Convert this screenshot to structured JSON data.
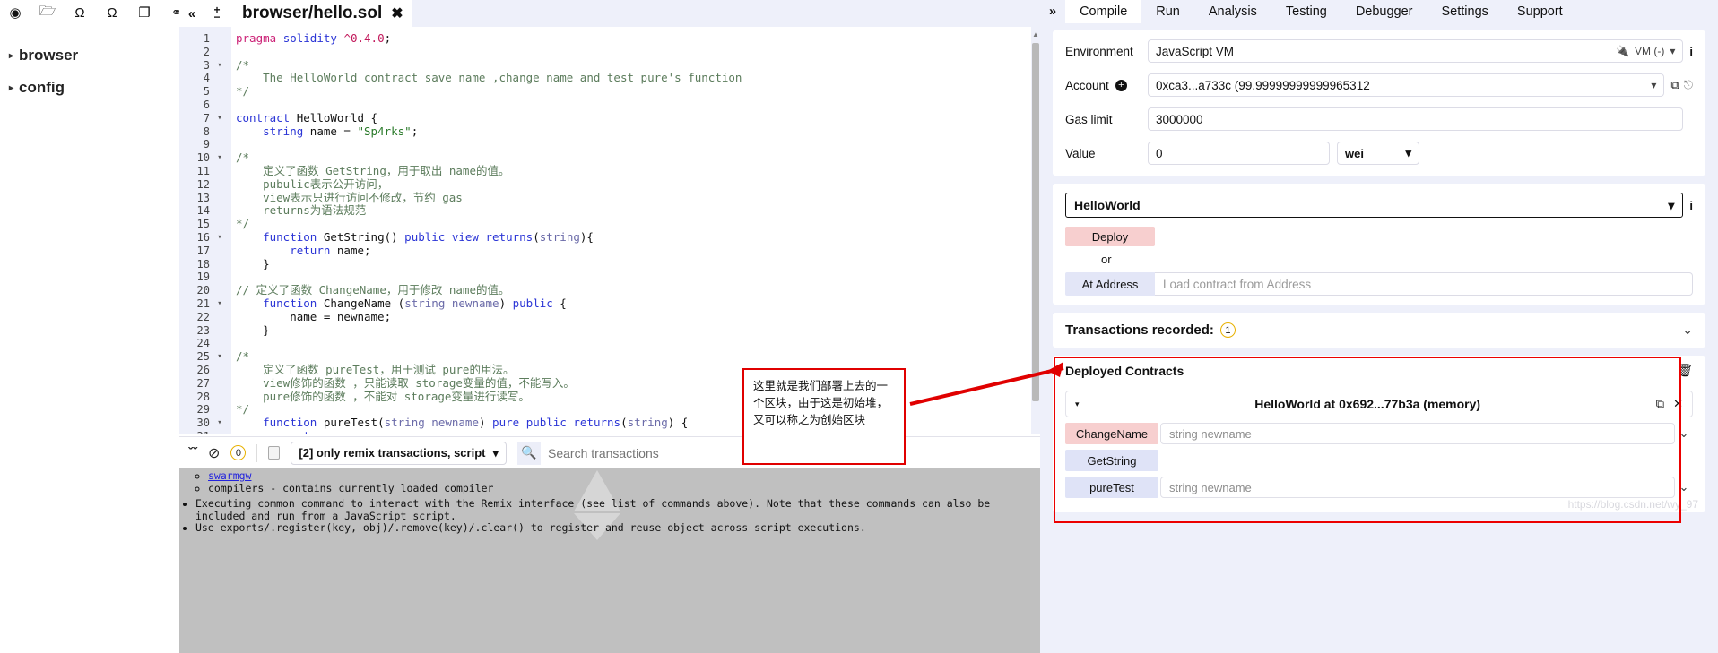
{
  "toolbar": {
    "icons": [
      {
        "name": "connect-icon",
        "glyph": "◉"
      },
      {
        "name": "folder-open-icon",
        "glyph": "🗁"
      },
      {
        "name": "github-icon",
        "glyph": "Ω"
      },
      {
        "name": "gist-icon",
        "glyph": "Ω"
      },
      {
        "name": "copy-files-icon",
        "glyph": "❐"
      },
      {
        "name": "link-icon",
        "glyph": "⚭"
      }
    ]
  },
  "explorer": {
    "items": [
      {
        "label": "browser",
        "caret": "▸"
      },
      {
        "label": "config",
        "caret": "▸"
      }
    ]
  },
  "editor": {
    "collapse_glyph": "«",
    "zoom_in": "+",
    "zoom_out": "−",
    "tab_title": "browser/hello.sol",
    "tab_close": "✖",
    "lines": [
      {
        "n": 1,
        "fold": "",
        "html": "<span class='pk'>pragma</span> <span class='k'>solidity</span> <span class='num'>^0.4.0</span>;"
      },
      {
        "n": 2,
        "fold": "",
        "html": ""
      },
      {
        "n": 3,
        "fold": "▾",
        "html": "<span class='cmt'>/*</span>"
      },
      {
        "n": 4,
        "fold": "",
        "html": "<span class='cmt'>    The HelloWorld contract save name ,change name and test pure's function</span>"
      },
      {
        "n": 5,
        "fold": "",
        "html": "<span class='cmt'>*/</span>"
      },
      {
        "n": 6,
        "fold": "",
        "html": ""
      },
      {
        "n": 7,
        "fold": "▾",
        "html": "<span class='k'>contract</span> <span class='pl'>HelloWorld</span> {"
      },
      {
        "n": 8,
        "fold": "",
        "html": "    <span class='k'>string</span> <span class='pl'>name</span> = <span class='str'>\"Sp4rks\"</span>;"
      },
      {
        "n": 9,
        "fold": "",
        "html": ""
      },
      {
        "n": 10,
        "fold": "▾",
        "html": "<span class='cmt'>/*</span>"
      },
      {
        "n": 11,
        "fold": "",
        "html": "<span class='cmt'>    定义了函数 GetString，用于取出 name的值。</span>"
      },
      {
        "n": 12,
        "fold": "",
        "html": "<span class='cmt'>    pubulic表示公开访问，</span>"
      },
      {
        "n": 13,
        "fold": "",
        "html": "<span class='cmt'>    view表示只进行访问不修改，节约 gas</span>"
      },
      {
        "n": 14,
        "fold": "",
        "html": "<span class='cmt'>    returns为语法规范</span>"
      },
      {
        "n": 15,
        "fold": "",
        "html": "<span class='cmt'>*/</span>"
      },
      {
        "n": 16,
        "fold": "▾",
        "html": "    <span class='fn'>function</span> <span class='pl'>GetString</span>() <span class='k'>public</span> <span class='k'>view</span> <span class='k'>returns</span>(<span class='ty'>string</span>){"
      },
      {
        "n": 17,
        "fold": "",
        "html": "        <span class='k'>return</span> <span class='pl'>name</span>;"
      },
      {
        "n": 18,
        "fold": "",
        "html": "    }"
      },
      {
        "n": 19,
        "fold": "",
        "html": ""
      },
      {
        "n": 20,
        "fold": "",
        "html": "<span class='cmt'>// 定义了函数 ChangeName，用于修改 name的值。</span>"
      },
      {
        "n": 21,
        "fold": "▾",
        "html": "    <span class='fn'>function</span> <span class='pl'>ChangeName</span> (<span class='ty'>string</span> <span class='ty'>newname</span>) <span class='k'>public</span> {"
      },
      {
        "n": 22,
        "fold": "",
        "html": "        <span class='pl'>name</span> = <span class='pl'>newname</span>;"
      },
      {
        "n": 23,
        "fold": "",
        "html": "    }"
      },
      {
        "n": 24,
        "fold": "",
        "html": ""
      },
      {
        "n": 25,
        "fold": "▾",
        "html": "<span class='cmt'>/*</span>"
      },
      {
        "n": 26,
        "fold": "",
        "html": "<span class='cmt'>    定义了函数 pureTest，用于测试 pure的用法。</span>"
      },
      {
        "n": 27,
        "fold": "",
        "html": "<span class='cmt'>    view修饰的函数 ，只能读取 storage变量的值，不能写入。</span>"
      },
      {
        "n": 28,
        "fold": "",
        "html": "<span class='cmt'>    pure修饰的函数 ，不能对 storage变量进行读写。</span>"
      },
      {
        "n": 29,
        "fold": "",
        "html": "<span class='cmt'>*/</span>"
      },
      {
        "n": 30,
        "fold": "▾",
        "html": "    <span class='fn'>function</span> <span class='pl'>pureTest</span>(<span class='ty'>string</span> <span class='ty'>newname</span>) <span class='k'>pure</span> <span class='k'>public</span> <span class='k'>returns</span>(<span class='ty'>string</span>) {"
      },
      {
        "n": 31,
        "fold": "",
        "html": "        <span class='k'>return</span> <span class='pl'>newname</span>;"
      }
    ]
  },
  "terminal": {
    "chevron_glyph": "ˇˇ",
    "ban_glyph": "⊘",
    "warn_count": "0",
    "filter_label": "[2] only remix transactions, script",
    "filter_caret": "▾",
    "search_icon": "🔍",
    "search_placeholder": "Search transactions",
    "log_lines": [
      {
        "type": "sub-link",
        "text": "swarmgw"
      },
      {
        "type": "sub",
        "text": "compilers - contains currently loaded compiler"
      },
      {
        "type": "main",
        "text": "Executing common command to interact with the Remix interface (see list of commands above). Note that these commands can also be included and run from a JavaScript script."
      },
      {
        "type": "main",
        "text": "Use exports/.register(key, obj)/.remove(key)/.clear() to register and reuse object across script executions."
      }
    ]
  },
  "right_tabs": {
    "expand_glyph": "»",
    "items": [
      {
        "label": "Compile",
        "active": true
      },
      {
        "label": "Run",
        "active": false
      },
      {
        "label": "Analysis",
        "active": false
      },
      {
        "label": "Testing",
        "active": false
      },
      {
        "label": "Debugger",
        "active": false
      },
      {
        "label": "Settings",
        "active": false
      },
      {
        "label": "Support",
        "active": false
      }
    ]
  },
  "run_panel": {
    "environment": {
      "label": "Environment",
      "value": "JavaScript VM",
      "status": "VM (-)",
      "plug_icon": "🔌",
      "caret": "▾",
      "info_icon": "i"
    },
    "account": {
      "label": "Account",
      "plus_icon": "+",
      "value": "0xca3...a733c (99.99999999999965312",
      "caret": "▾",
      "copy_icon": "⧉",
      "extra_icon": "⎋"
    },
    "gas_limit": {
      "label": "Gas limit",
      "value": "3000000"
    },
    "value": {
      "label": "Value",
      "value": "0",
      "unit": "wei",
      "unit_caret": "▾"
    },
    "contract_select": {
      "value": "HelloWorld",
      "caret": "▾",
      "info_icon": "i"
    },
    "deploy_label": "Deploy",
    "or_label": "or",
    "at_address_label": "At Address",
    "at_address_placeholder": "Load contract from Address",
    "transactions": {
      "label": "Transactions recorded:",
      "count": "1",
      "chevron": "⌄"
    },
    "deployed": {
      "title": "Deployed Contracts",
      "trash_icon": "🗑",
      "instance": {
        "caret": "▾",
        "name": "HelloWorld at 0x692...77b3a (memory)",
        "copy_icon": "⧉",
        "close_icon": "✕"
      },
      "functions": [
        {
          "name": "ChangeName",
          "kind": "write",
          "placeholder": "string newname",
          "chevron": "⌄"
        },
        {
          "name": "GetString",
          "kind": "read",
          "placeholder": "",
          "chevron": ""
        },
        {
          "name": "pureTest",
          "kind": "read",
          "placeholder": "string newname",
          "chevron": "⌄"
        }
      ],
      "watermark": "https://blog.csdn.net/wy_97"
    }
  },
  "annotation": {
    "text": "这里就是我们部署上去的一个区块，由于这是初始堆，又可以称之为创始区块",
    "color": "#e00000"
  }
}
